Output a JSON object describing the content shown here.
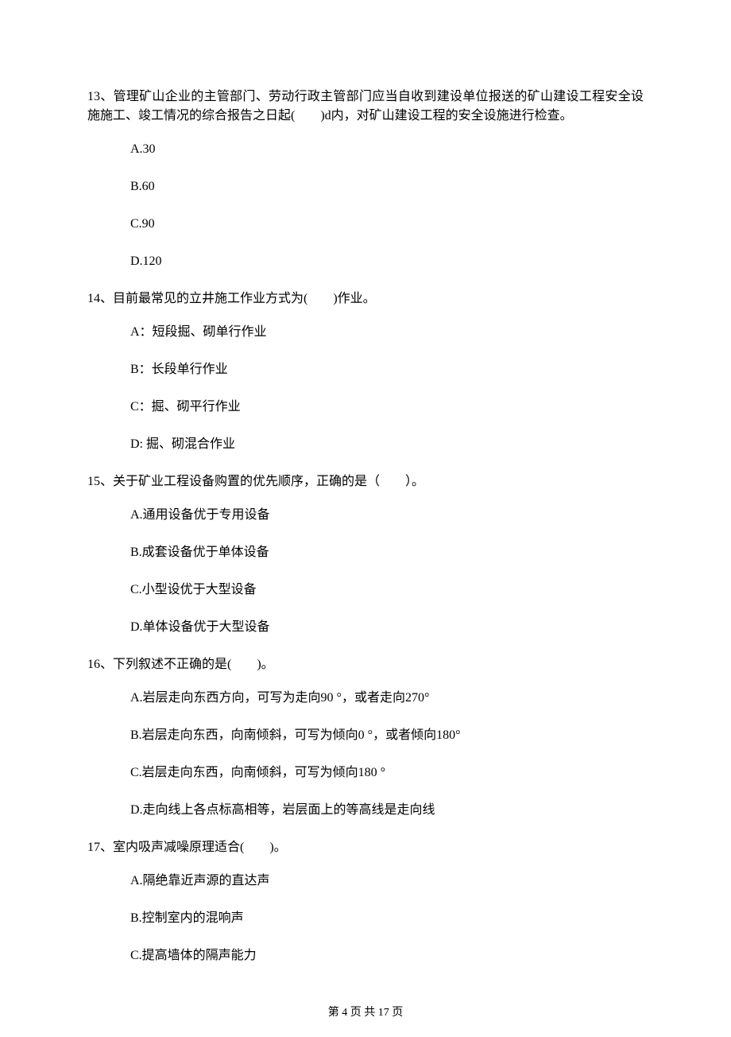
{
  "questions": [
    {
      "text": "13、管理矿山企业的主管部门、劳动行政主管部门应当自收到建设单位报送的矿山建设工程安全设施施工、竣工情况的综合报告之日起(　　)d内，对矿山建设工程的安全设施进行检查。",
      "options": [
        "A.30",
        "B.60",
        "C.90",
        "D.120"
      ]
    },
    {
      "text": "14、目前最常见的立井施工作业方式为(　　)作业。",
      "options": [
        "A：短段掘、砌单行作业",
        "B：长段单行作业",
        "C：掘、砌平行作业",
        "D: 掘、砌混合作业"
      ]
    },
    {
      "text": "15、关于矿业工程设备购置的优先顺序，正确的是（　　）。",
      "options": [
        "A.通用设备优于专用设备",
        "B.成套设备优于单体设备",
        "C.小型设优于大型设备",
        "D.单体设备优于大型设备"
      ]
    },
    {
      "text": "16、下列叙述不正确的是(　　)。",
      "options": [
        "A.岩层走向东西方向，可写为走向90 °，或者走向270°",
        "B.岩层走向东西，向南倾斜，可写为倾向0 °，或者倾向180°",
        "C.岩层走向东西，向南倾斜，可写为倾向180 °",
        "D.走向线上各点标高相等，岩层面上的等高线是走向线"
      ]
    },
    {
      "text": "17、室内吸声减噪原理适合(　　)。",
      "options": [
        "A.隔绝靠近声源的直达声",
        "B.控制室内的混响声",
        "C.提高墙体的隔声能力"
      ]
    }
  ],
  "footer": "第 4 页 共 17 页"
}
